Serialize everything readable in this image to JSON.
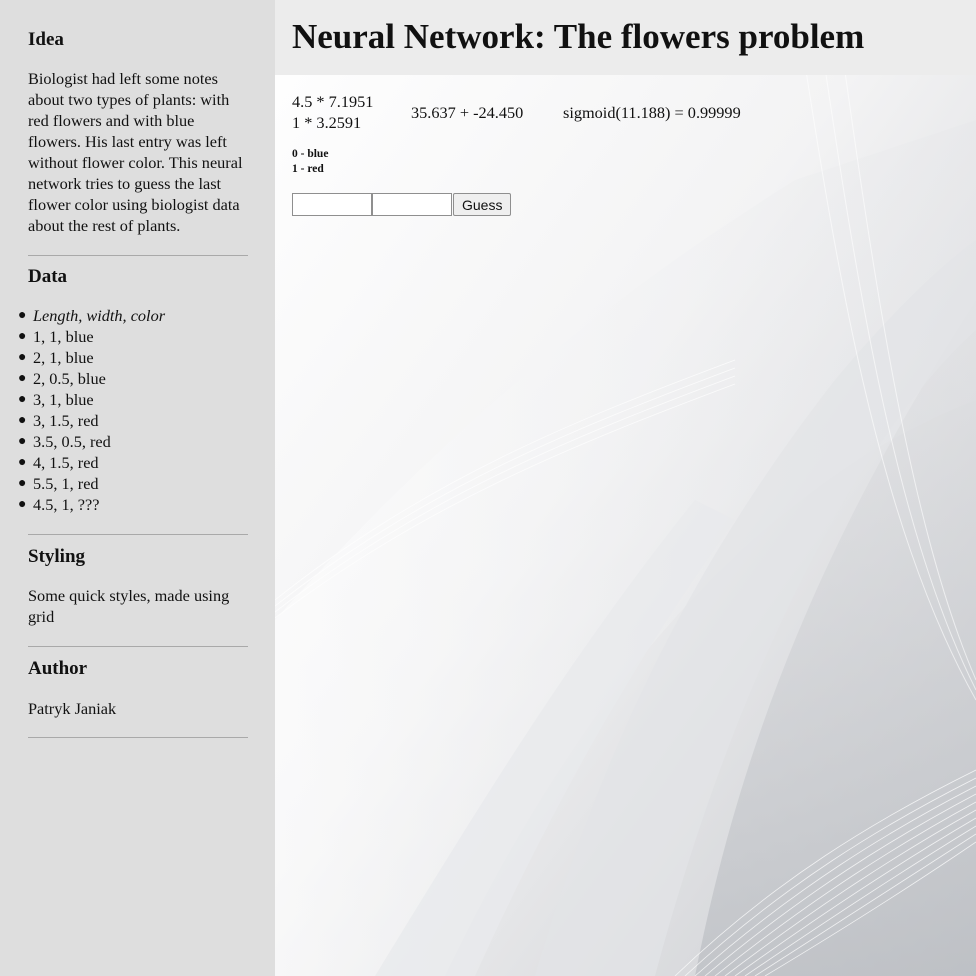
{
  "sidebar": {
    "idea": {
      "title": "Idea",
      "text": "Biologist had left some notes about two types of plants: with red flowers and with blue flowers. His last entry was left without flower color. This neural network tries to guess the last flower color using biologist data about the rest of plants."
    },
    "data": {
      "title": "Data",
      "items": [
        "Length, width, color",
        "1, 1, blue",
        "2, 1, blue",
        "2, 0.5, blue",
        "3, 1, blue",
        "3, 1.5, red",
        "3.5, 0.5, red",
        "4, 1.5, red",
        "5.5, 1, red",
        "4.5, 1, ???"
      ]
    },
    "styling": {
      "title": "Styling",
      "text": "Some quick styles, made using grid"
    },
    "author": {
      "title": "Author",
      "text": "Patryk Janiak"
    }
  },
  "main": {
    "title": "Neural Network: The flowers problem",
    "calc": {
      "mult1": "4.5 * 7.1951",
      "mult2": "1 * 3.2591",
      "sum": "35.637 + -24.450",
      "sigmoid": "sigmoid(11.188) = 0.99999"
    },
    "legend": {
      "line1": "0 - blue",
      "line2": "1 - red"
    },
    "form": {
      "input1_value": "",
      "input2_value": "",
      "guess_label": "Guess"
    }
  },
  "colors": {
    "sidebar_bg": "#dedede",
    "main_bg": "#ececec",
    "divider": "#a9a9a9"
  }
}
